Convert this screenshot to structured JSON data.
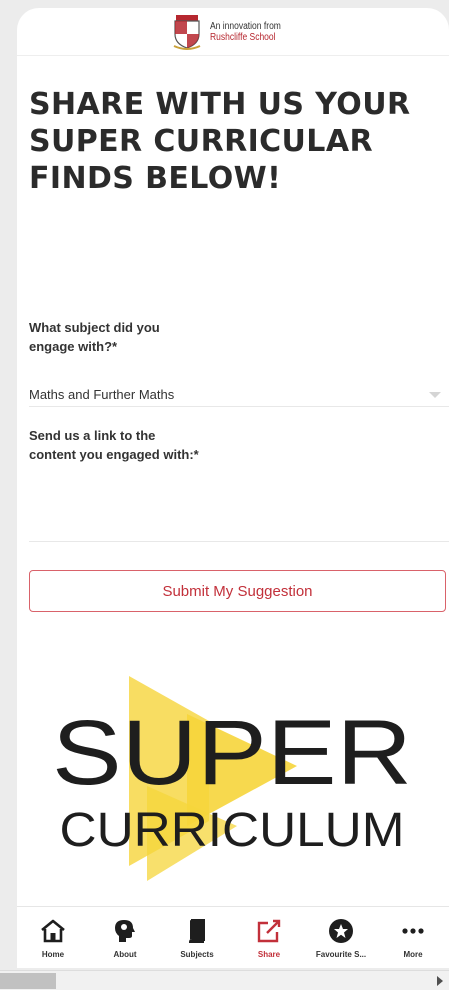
{
  "header": {
    "logo_icon": "school-crest",
    "line1": "An innovation from",
    "line2": "Rushcliffe School"
  },
  "headline": "SHARE WITH US YOUR SUPER CURRICULAR FINDS BELOW!",
  "form": {
    "subject_label": "What subject did you engage with?*",
    "subject_value": "Maths and Further Maths",
    "link_label": "Send us a link to the content you engaged with:*",
    "link_value": "",
    "submit_label": "Submit My Suggestion"
  },
  "logo": {
    "line1": "SUPER",
    "line2": "CURRICULUM",
    "accent_color": "#f6d53b"
  },
  "tabs": [
    {
      "label": "Home",
      "icon": "home-icon",
      "active": false
    },
    {
      "label": "About",
      "icon": "head-icon",
      "active": false
    },
    {
      "label": "Subjects",
      "icon": "book-icon",
      "active": false
    },
    {
      "label": "Share",
      "icon": "share-icon",
      "active": true
    },
    {
      "label": "Favourite S...",
      "icon": "star-icon",
      "active": false
    },
    {
      "label": "More",
      "icon": "ellipsis-icon",
      "active": false
    }
  ],
  "colors": {
    "accent": "#c2303a",
    "heading": "#2b2b2b"
  }
}
